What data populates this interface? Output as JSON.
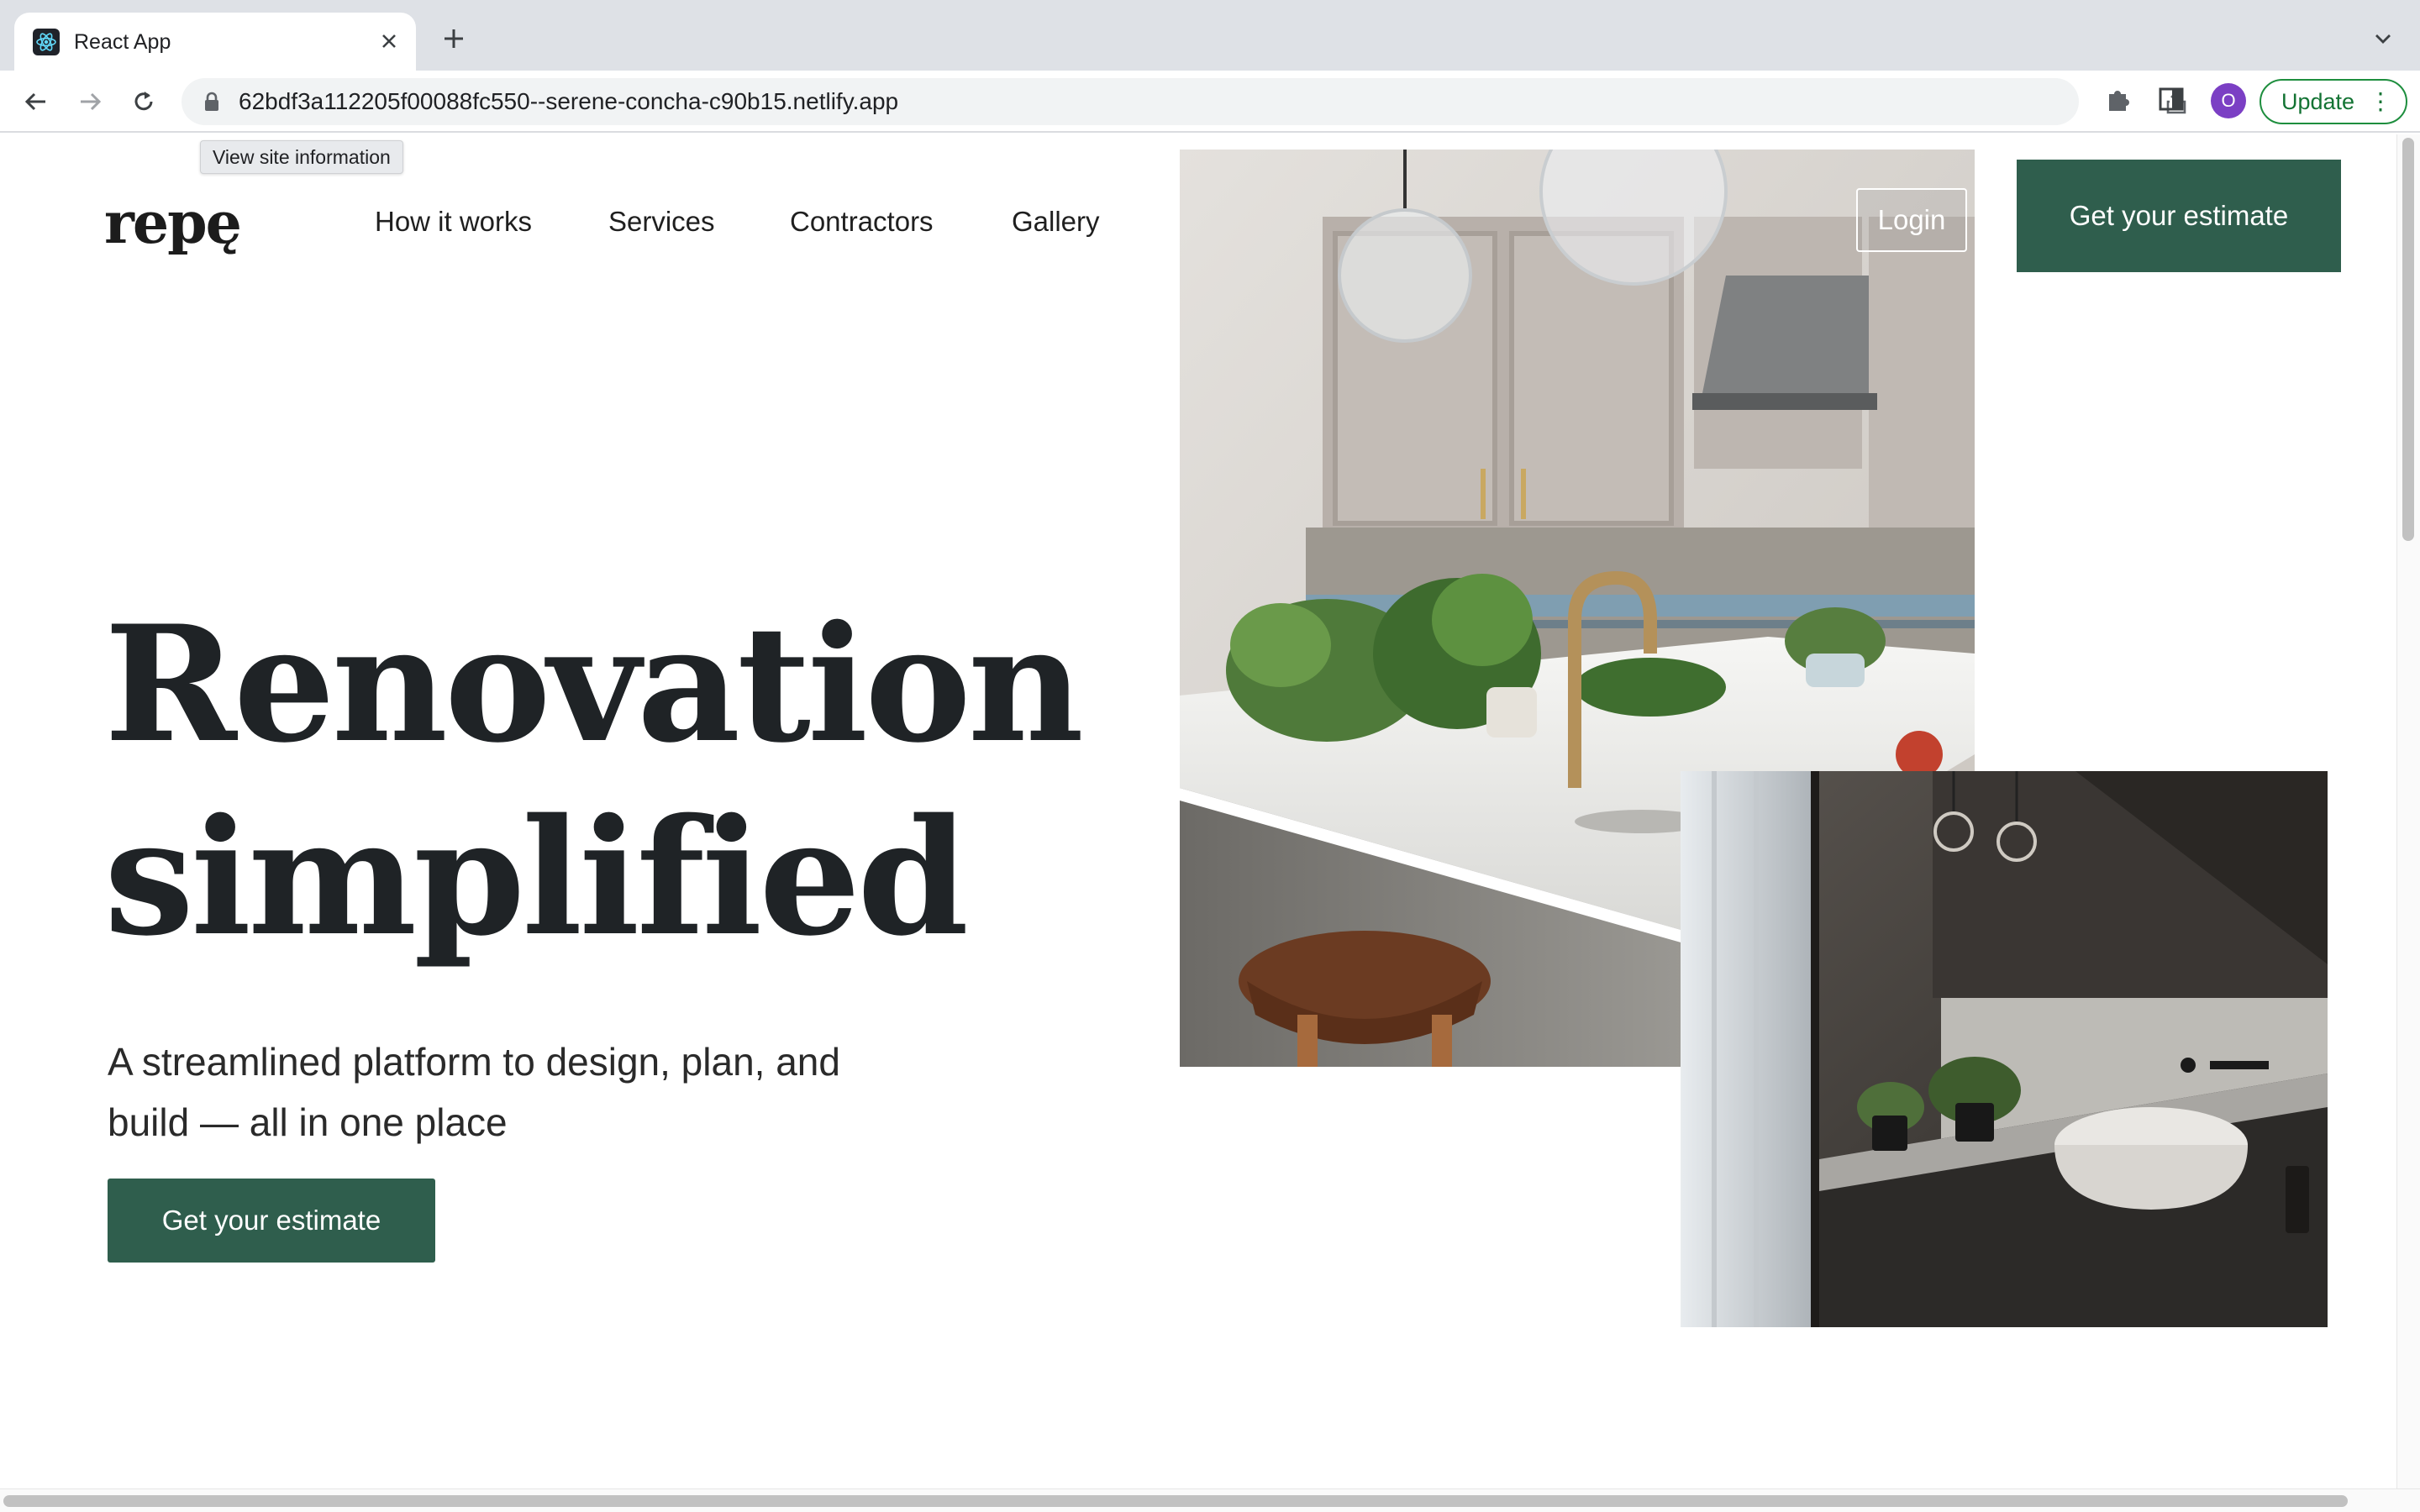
{
  "browser": {
    "tab_title": "React App",
    "url": "62bdf3a112205f00088fc550--serene-concha-c90b15.netlify.app",
    "tooltip": "View site information",
    "profile_initial": "O",
    "update_label": "Update"
  },
  "site": {
    "logo": "repę",
    "nav": {
      "how": "How it works",
      "services": "Services",
      "contractors": "Contractors",
      "gallery": "Gallery"
    },
    "login_label": "Login",
    "header_cta": "Get your estimate"
  },
  "hero": {
    "title_line1": "Renovation",
    "title_line2": "simplified",
    "subtitle": "A streamlined platform to design, plan, and build — all in one place",
    "cta": "Get your estimate"
  },
  "colors": {
    "brand_green": "#2f5e4d",
    "text_dark": "#1f2326"
  }
}
